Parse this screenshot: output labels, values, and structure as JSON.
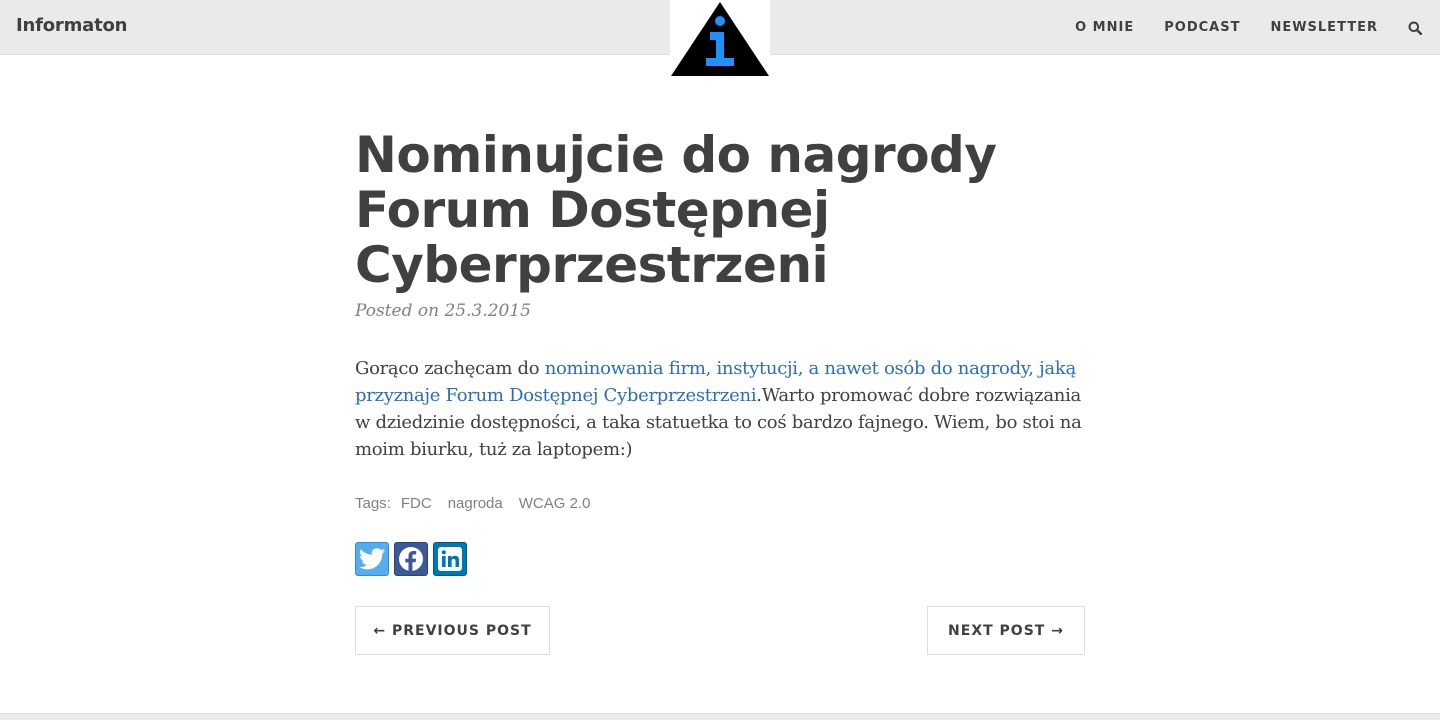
{
  "navbar": {
    "brand": "Informaton",
    "links": [
      "O MNIE",
      "PODCAST",
      "NEWSLETTER"
    ]
  },
  "icons": {
    "logo": "info-triangle-icon",
    "search": "search-icon",
    "twitter": "twitter-icon",
    "facebook": "facebook-icon",
    "linkedin": "linkedin-icon"
  },
  "post": {
    "title": "Nominujcie do nagrody Forum Dostępnej Cyberprzestrzeni",
    "meta": "Posted on 25.3.2015",
    "body_prefix": "Gorąco zachęcam do ",
    "body_link": "nominowania firm, instytucji, a nawet osób do nagrody, jaką przyznaje Forum Dostępnej Cyberprzestrzeni",
    "body_suffix": ".Warto promować dobre rozwiązania w dziedzinie dostępności, a taka statuetka to coś bardzo fajnego. Wiem, bo stoi na moim biurku, tuż za laptopem:)"
  },
  "tags": {
    "label": "Tags:",
    "items": [
      "FDC",
      "nagroda",
      "WCAG 2.0"
    ]
  },
  "pager": {
    "previous": "← PREVIOUS POST",
    "next": "NEXT POST →"
  },
  "colors": {
    "link": "#2a6ebb",
    "navbar_bg": "#eaeaea",
    "logo_blue": "#1e90ff",
    "twitter": "#55acee",
    "facebook": "#3b5998",
    "linkedin": "#0077b5"
  }
}
